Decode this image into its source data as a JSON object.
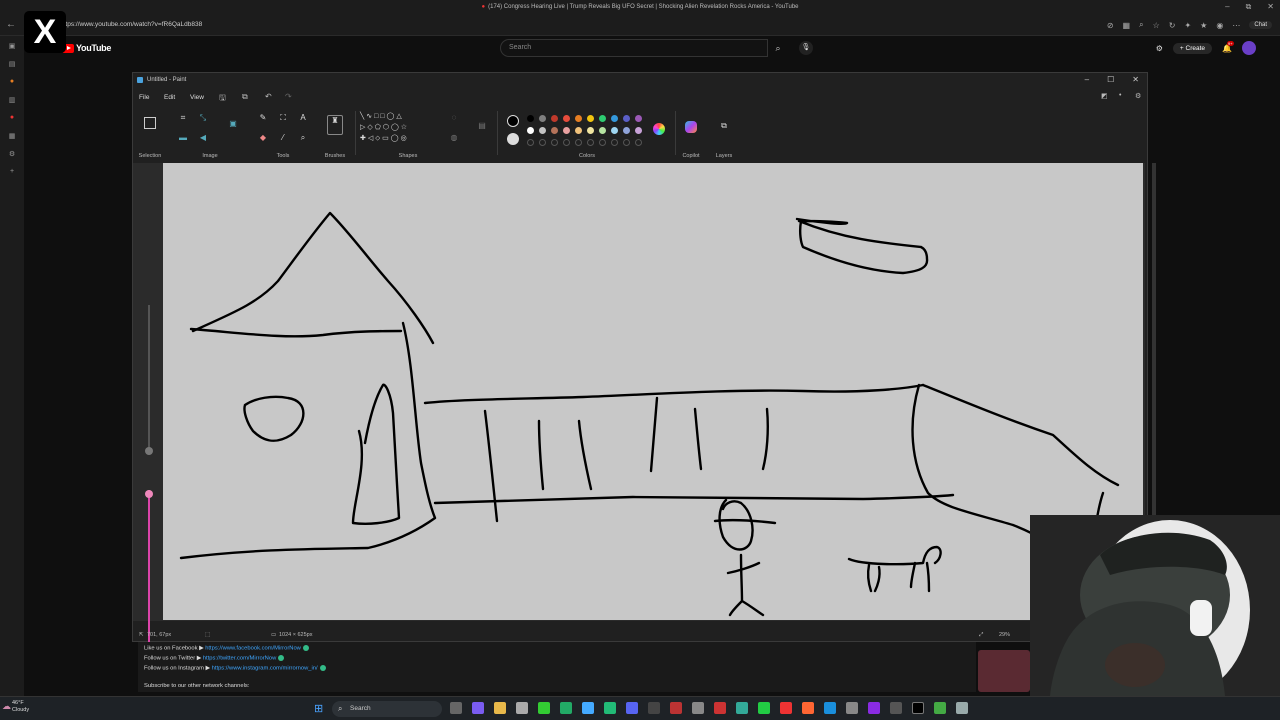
{
  "browser": {
    "tab_title": "(174) Congress Hearing Live | Trump Reveals Big UFO Secret | Shocking Alien Revelation Rocks America - YouTube",
    "url": "https://www.youtube.com/watch?v=fR6QaLdb838",
    "chat_label": "Chat"
  },
  "youtube": {
    "logo_text": "YouTube",
    "search_placeholder": "Search",
    "create_label": "Create",
    "notification_count": "9+"
  },
  "overlay_logo": "X",
  "paint": {
    "window_title": "Untitled - Paint",
    "menu": [
      "File",
      "Edit",
      "View"
    ],
    "groups": {
      "selection": "Selection",
      "image": "Image",
      "tools": "Tools",
      "brushes": "Brushes",
      "shapes": "Shapes",
      "colors": "Colors",
      "copilot": "Copilot",
      "layers": "Layers"
    },
    "colors_row1": [
      "#000000",
      "#7f7f7f",
      "#c0392b",
      "#e74c3c",
      "#e67e22",
      "#f1c40f",
      "#2ecc71",
      "#3498db",
      "#5b5fc7",
      "#9b59b6"
    ],
    "colors_row2": [
      "#ffffff",
      "#c3c3c3",
      "#b5735a",
      "#e8a0a0",
      "#f0c27b",
      "#efe4a0",
      "#b5e3a1",
      "#9ed5f0",
      "#8fa3d9",
      "#c8a2d8"
    ],
    "status": {
      "cursor_pos": "701, 67px",
      "canvas_size": "1024 × 625px",
      "zoom": "29%"
    }
  },
  "description": {
    "facebook_label": "Like us on Facebook ▶",
    "facebook_url": "https://www.facebook.com/MirrorNow",
    "twitter_label": "Follow us on Twitter ▶",
    "twitter_url": "https://twitter.com/MirrorNow",
    "instagram_label": "Follow us on Instagram ▶",
    "instagram_url": "https://www.instagram.com/mirrornow_in/",
    "other_channels": "Subscribe to our other network channels:"
  },
  "taskbar": {
    "temperature": "46°F",
    "condition": "Cloudy",
    "search_label": "Search"
  }
}
